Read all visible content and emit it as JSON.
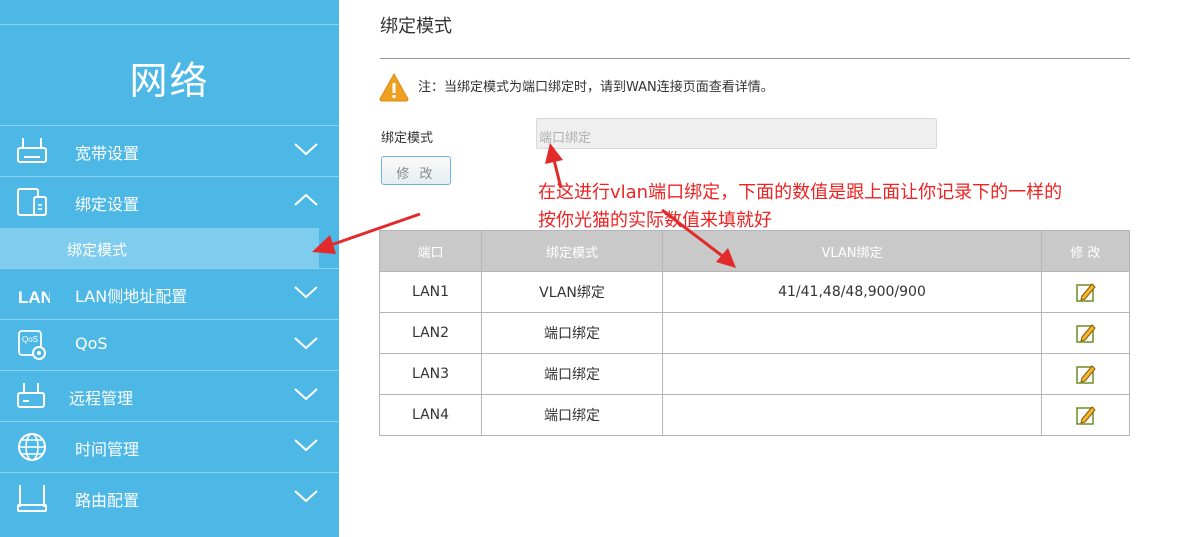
{
  "sidebar": {
    "title": "网络",
    "items": [
      {
        "label": "宽带设置",
        "icon": "router-icon"
      },
      {
        "label": "绑定设置",
        "icon": "devices-icon"
      },
      {
        "label": "LAN侧地址配置",
        "icon": "lan-icon",
        "icon_text": "LAN"
      },
      {
        "label": "QoS",
        "icon": "qos-gear-icon",
        "icon_text": "QoS"
      },
      {
        "label": "远程管理",
        "icon": "remote-router-icon"
      },
      {
        "label": "时间管理",
        "icon": "globe-icon"
      },
      {
        "label": "路由配置",
        "icon": "routing-icon"
      }
    ],
    "sub_item": {
      "label": "绑定模式"
    }
  },
  "main": {
    "title": "绑定模式",
    "notice": "注：当绑定模式为端口绑定时，请到WAN连接页面查看详情。",
    "mode_label": "绑定模式",
    "mode_value": "端口绑定",
    "edit_button": "修 改",
    "table": {
      "headers": [
        "端口",
        "绑定模式",
        "VLAN绑定",
        "修 改"
      ],
      "rows": [
        {
          "port": "LAN1",
          "mode": "VLAN绑定",
          "vlan": "41/41,48/48,900/900"
        },
        {
          "port": "LAN2",
          "mode": "端口绑定",
          "vlan": ""
        },
        {
          "port": "LAN3",
          "mode": "端口绑定",
          "vlan": ""
        },
        {
          "port": "LAN4",
          "mode": "端口绑定",
          "vlan": ""
        }
      ]
    }
  },
  "annotation": {
    "line1": "在这进行vlan端口绑定，下面的数值是跟上面让你记录下的一样的",
    "line2": "按你光猫的实际数值来填就好",
    "color": "#ee2222"
  },
  "colors": {
    "sidebar": "#4db8e5",
    "sidebar_active": "#7fcdee",
    "table_header": "#c9c9c9"
  }
}
